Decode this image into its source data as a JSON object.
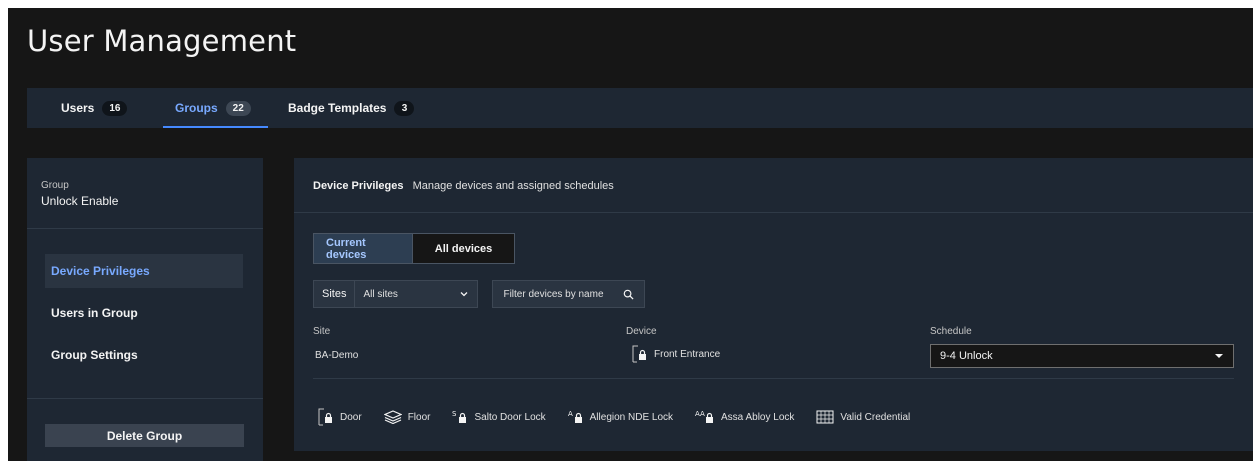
{
  "page": {
    "title": "User Management"
  },
  "tabs": [
    {
      "label": "Users",
      "count": "16"
    },
    {
      "label": "Groups",
      "count": "22"
    },
    {
      "label": "Badge Templates",
      "count": "3"
    }
  ],
  "group": {
    "caption": "Group",
    "name": "Unlock Enable"
  },
  "sidebar": {
    "items": [
      {
        "label": "Device Privileges"
      },
      {
        "label": "Users in Group"
      },
      {
        "label": "Group Settings"
      }
    ],
    "delete_label": "Delete Group"
  },
  "main": {
    "title": "Device Privileges",
    "subtitle": "Manage devices and assigned schedules",
    "segments": [
      {
        "label": "Current devices"
      },
      {
        "label": "All devices"
      }
    ],
    "sites_label": "Sites",
    "sites_value": "All sites",
    "search_placeholder": "Filter devices by name",
    "columns": {
      "site": "Site",
      "device": "Device",
      "schedule": "Schedule"
    },
    "rows": [
      {
        "site": "BA-Demo",
        "device": "Front Entrance",
        "device_icon": "door-lock-icon",
        "schedule": "9-4 Unlock"
      }
    ],
    "legend": [
      {
        "label": "Door",
        "icon": "door-lock-icon"
      },
      {
        "label": "Floor",
        "icon": "floor-layers-icon"
      },
      {
        "label": "Salto Door Lock",
        "icon": "salto-lock-icon"
      },
      {
        "label": "Allegion NDE Lock",
        "icon": "allegion-lock-icon"
      },
      {
        "label": "Assa Abloy Lock",
        "icon": "assa-abloy-lock-icon"
      },
      {
        "label": "Valid Credential",
        "icon": "credential-grid-icon"
      }
    ]
  },
  "colors": {
    "background": "#161616",
    "panel": "#1e2733",
    "accent": "#78a9ff",
    "active_nav": "#2a3441"
  }
}
